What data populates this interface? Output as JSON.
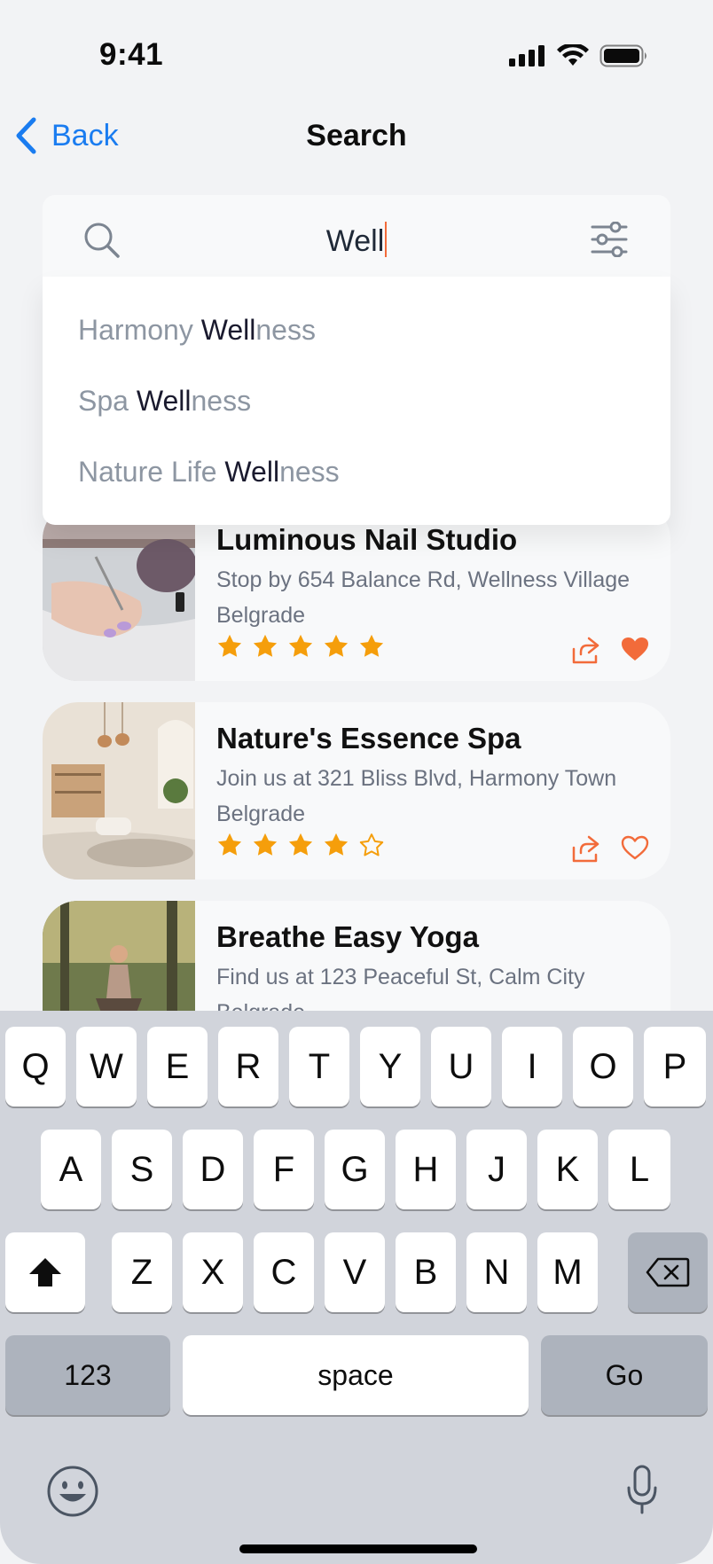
{
  "status_bar": {
    "time": "9:41"
  },
  "nav": {
    "back_label": "Back",
    "title": "Search"
  },
  "search": {
    "value": "Well"
  },
  "suggestions": [
    {
      "prefix": "Harmony ",
      "match": "Well",
      "suffix": "ness"
    },
    {
      "prefix": "Spa ",
      "match": "Well",
      "suffix": "ness"
    },
    {
      "prefix": "Nature Life ",
      "match": "Well",
      "suffix": "ness"
    }
  ],
  "results": [
    {
      "title": "Luminous Nail Studio",
      "address": "Stop by 654 Balance Rd, Wellness Village",
      "city": "Belgrade",
      "rating": 5,
      "favorited": true
    },
    {
      "title": "Nature's Essence Spa",
      "address": "Join us at 321 Bliss Blvd, Harmony Town",
      "city": "Belgrade",
      "rating": 4,
      "favorited": false
    },
    {
      "title": "Breathe Easy Yoga",
      "address": "Find us at 123 Peaceful St, Calm City",
      "city": "Belgrade",
      "rating": null,
      "favorited": null
    }
  ],
  "keyboard": {
    "row1": [
      "Q",
      "W",
      "E",
      "R",
      "T",
      "Y",
      "U",
      "I",
      "O",
      "P"
    ],
    "row2": [
      "A",
      "S",
      "D",
      "F",
      "G",
      "H",
      "J",
      "K",
      "L"
    ],
    "row3": [
      "Z",
      "X",
      "C",
      "V",
      "B",
      "N",
      "M"
    ],
    "numbers_label": "123",
    "space_label": "space",
    "go_label": "Go"
  },
  "colors": {
    "accent": "#f26b3a",
    "link": "#1a7cf0",
    "star": "#f59e0b"
  },
  "icons": [
    "chevron-left-icon",
    "search-icon",
    "filter-icon",
    "star-icon",
    "share-icon",
    "heart-icon",
    "shift-icon",
    "backspace-icon",
    "emoji-icon",
    "mic-icon"
  ]
}
